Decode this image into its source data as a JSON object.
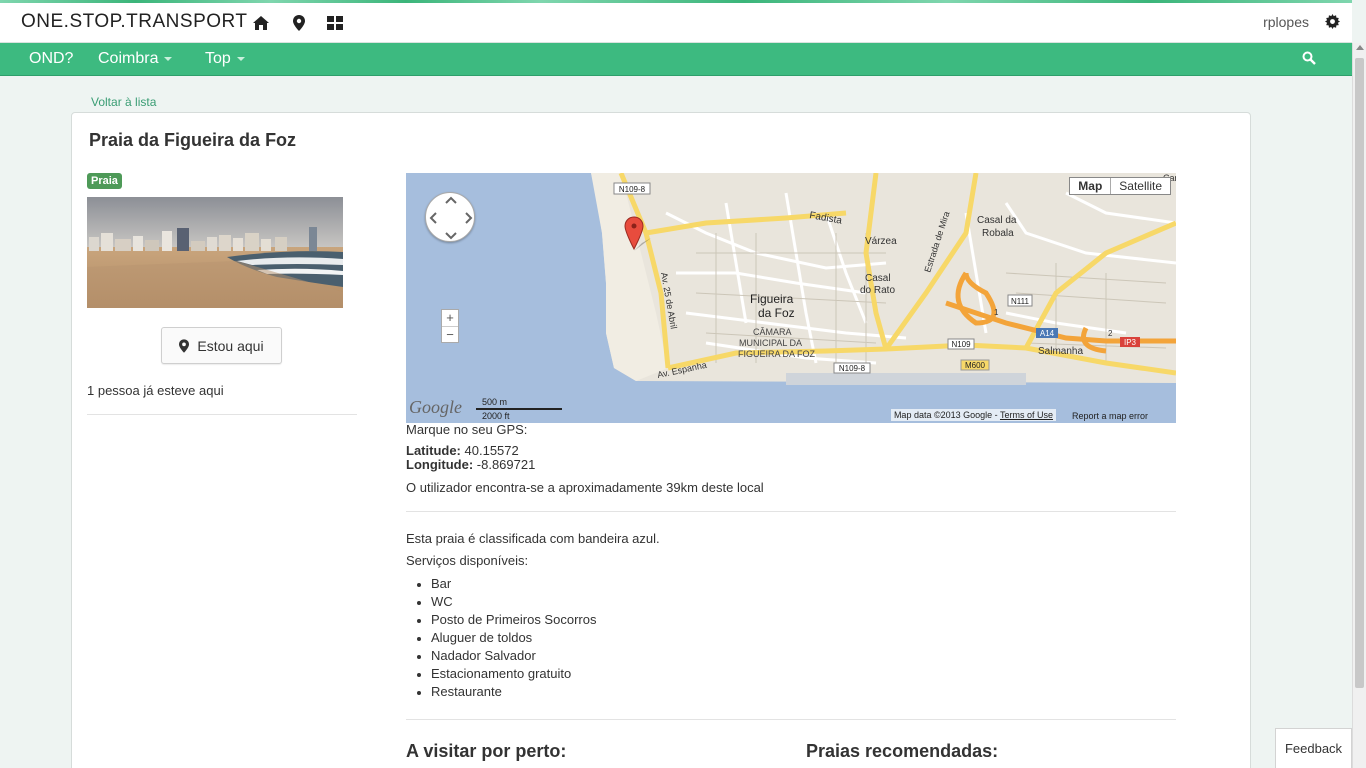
{
  "topbar": {
    "brand": "ONE.STOP.TRANSPORT",
    "icons": [
      "home-icon",
      "map-marker-icon",
      "grid-icon"
    ],
    "username": "rplopes",
    "settings_icon": "gear-icon"
  },
  "navbar": {
    "items": [
      {
        "label": "OND?",
        "dropdown": false
      },
      {
        "label": "Coimbra",
        "dropdown": true
      },
      {
        "label": "Top",
        "dropdown": true
      }
    ],
    "search_icon": "search-icon"
  },
  "back_link": "Voltar à lista",
  "place": {
    "title": "Praia da Figueira da Foz",
    "badge": "Praia",
    "checkin_button": "Estou aqui",
    "visited_text": "1 pessoa já esteve aqui"
  },
  "map": {
    "type_buttons": [
      "Map",
      "Satellite"
    ],
    "labels": {
      "road_n109_8_top": "N109-8",
      "fadista": "Fadista",
      "varzea": "Várzea",
      "casal_robala": "Casal da\nRobala",
      "casal_rato": "Casal\ndo Rato",
      "estrada_mira": "Estrada de Mira",
      "av_25_abril": "Av. 25 de Abril",
      "figueira": "Figueira\nda Foz",
      "camara": "CÂMARA\nMUNICIPAL DA\nFIGUEIRA DA FOZ",
      "n111": "N111",
      "a14": "A14",
      "ip3": "IP3",
      "salmanha": "Salmanha",
      "n109": "N109",
      "m600": "M600",
      "n109_8_bottom": "N109-8",
      "espanha": "Av. Espanha",
      "car": "Car"
    },
    "scale_metric": "500 m",
    "scale_imperial": "2000 ft",
    "logo": "Google",
    "attribution": "Map data ©2013 Google - ",
    "terms": "Terms of Use",
    "report": "Report a map error"
  },
  "gps": {
    "intro": "Marque no seu GPS:",
    "lat_label": "Latitude:",
    "lat_value": "40.15572",
    "lon_label": "Longitude:",
    "lon_value": "-8.869721"
  },
  "distance_text": "O utilizador encontra-se a aproximadamente 39km deste local",
  "description": {
    "flag_text": "Esta praia é classificada com bandeira azul.",
    "services_title": "Serviços disponíveis:",
    "services": [
      "Bar",
      "WC",
      "Posto de Primeiros Socorros",
      "Aluguer de toldos",
      "Nadador Salvador",
      "Estacionamento gratuito",
      "Restaurante"
    ]
  },
  "sections": {
    "nearby": "A visitar por perto:",
    "recommended": "Praias recomendadas:"
  },
  "feedback": "Feedback"
}
